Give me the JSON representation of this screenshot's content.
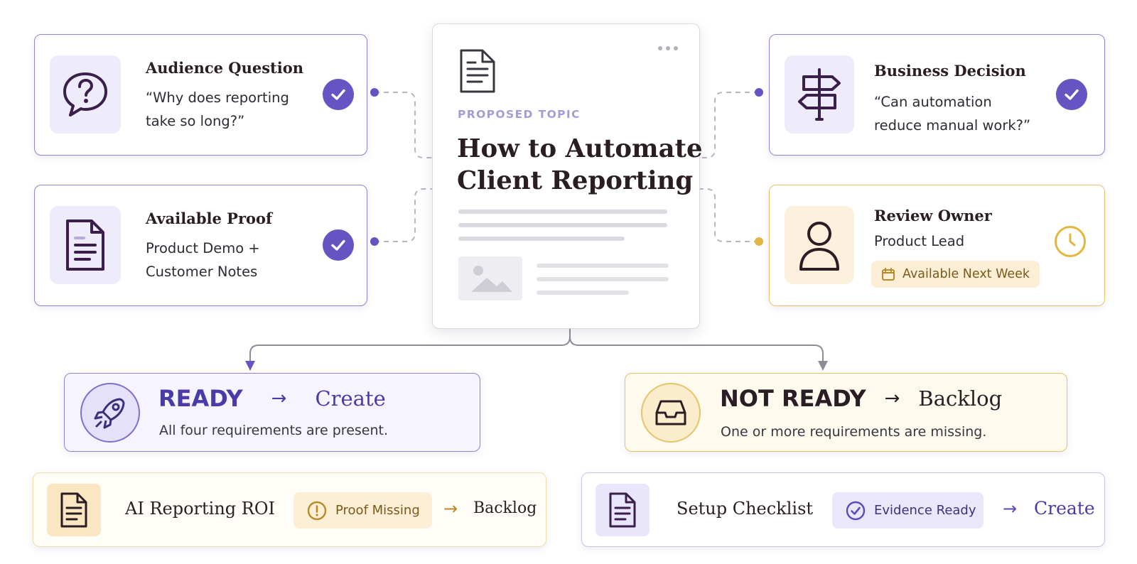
{
  "center": {
    "kicker": "PROPOSED TOPIC",
    "title_line1": "How to Automate",
    "title_line2": "Client Reporting",
    "icons": {
      "doc": "document-icon",
      "menu": "more-dots-icon",
      "image": "image-placeholder-icon"
    }
  },
  "cards": {
    "audience": {
      "title": "Audience Question",
      "line1": "“Why does reporting",
      "line2": "take so long?”",
      "icon": "question-bubble-icon",
      "status_icon": "check-circle-icon"
    },
    "proof": {
      "title": "Available Proof",
      "line1": "Product Demo +",
      "line2": "Customer Notes",
      "icon": "document-icon",
      "status_icon": "check-circle-icon"
    },
    "decision": {
      "title": "Business Decision",
      "line1": "“Can automation",
      "line2": "reduce manual work?”",
      "icon": "signpost-icon",
      "status_icon": "check-circle-icon"
    },
    "owner": {
      "title": "Review Owner",
      "line1": "Product Lead",
      "badge": "Available Next Week",
      "icon": "person-icon",
      "status_icon": "clock-icon",
      "badge_icon": "calendar-icon"
    }
  },
  "outcomes": {
    "ready": {
      "status": "READY",
      "arrow": "→",
      "action": "Create",
      "desc": "All four requirements are present.",
      "icon": "rocket-icon"
    },
    "not_ready": {
      "status": "NOT READY",
      "arrow": "→",
      "action": "Backlog",
      "desc": "One or more requirements are missing.",
      "icon": "inbox-tray-icon"
    }
  },
  "examples": [
    {
      "title": "AI Reporting ROI",
      "badge": "Proof Missing",
      "arrow": "→",
      "result": "Backlog",
      "icon": "document-icon",
      "badge_icon": "alert-circle-icon"
    },
    {
      "title": "Setup Checklist",
      "badge": "Evidence Ready",
      "arrow": "→",
      "result": "Create",
      "icon": "document-icon",
      "badge_icon": "check-circle-outline-icon"
    }
  ],
  "colors": {
    "purple": "#6554c2",
    "purple_border": "#8f83d6",
    "gold": "#e2b73f",
    "gold_border": "#e3c46a",
    "dark": "#2b1d24"
  }
}
